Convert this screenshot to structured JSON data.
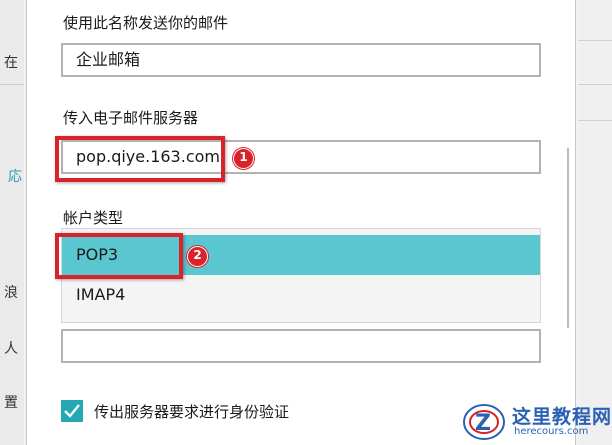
{
  "form": {
    "sender_name": {
      "label": "使用此名称发送你的邮件",
      "value": "企业邮箱"
    },
    "incoming_server": {
      "label": "传入电子邮件服务器",
      "value": "pop.qiye.163.com"
    },
    "account_type": {
      "label": "帐户类型",
      "options": [
        "POP3",
        "IMAP4"
      ],
      "selected": "POP3"
    },
    "outgoing_server": {
      "value": ""
    },
    "outgoing_auth": {
      "label": "传出服务器要求进行身份验证",
      "checked": true
    }
  },
  "annotations": {
    "step1": "1",
    "step2": "2"
  },
  "background": {
    "frag1": "在",
    "frag2": "応",
    "frag3": "浪",
    "frag4": "人",
    "frag5": "置"
  },
  "watermark": {
    "title": "这里教程网",
    "url": "herecours.com"
  },
  "colors": {
    "selected_row": "#59c6d0",
    "checkbox": "#25a7b4",
    "highlight": "#d8232a",
    "watermark": "#2a61b5"
  }
}
